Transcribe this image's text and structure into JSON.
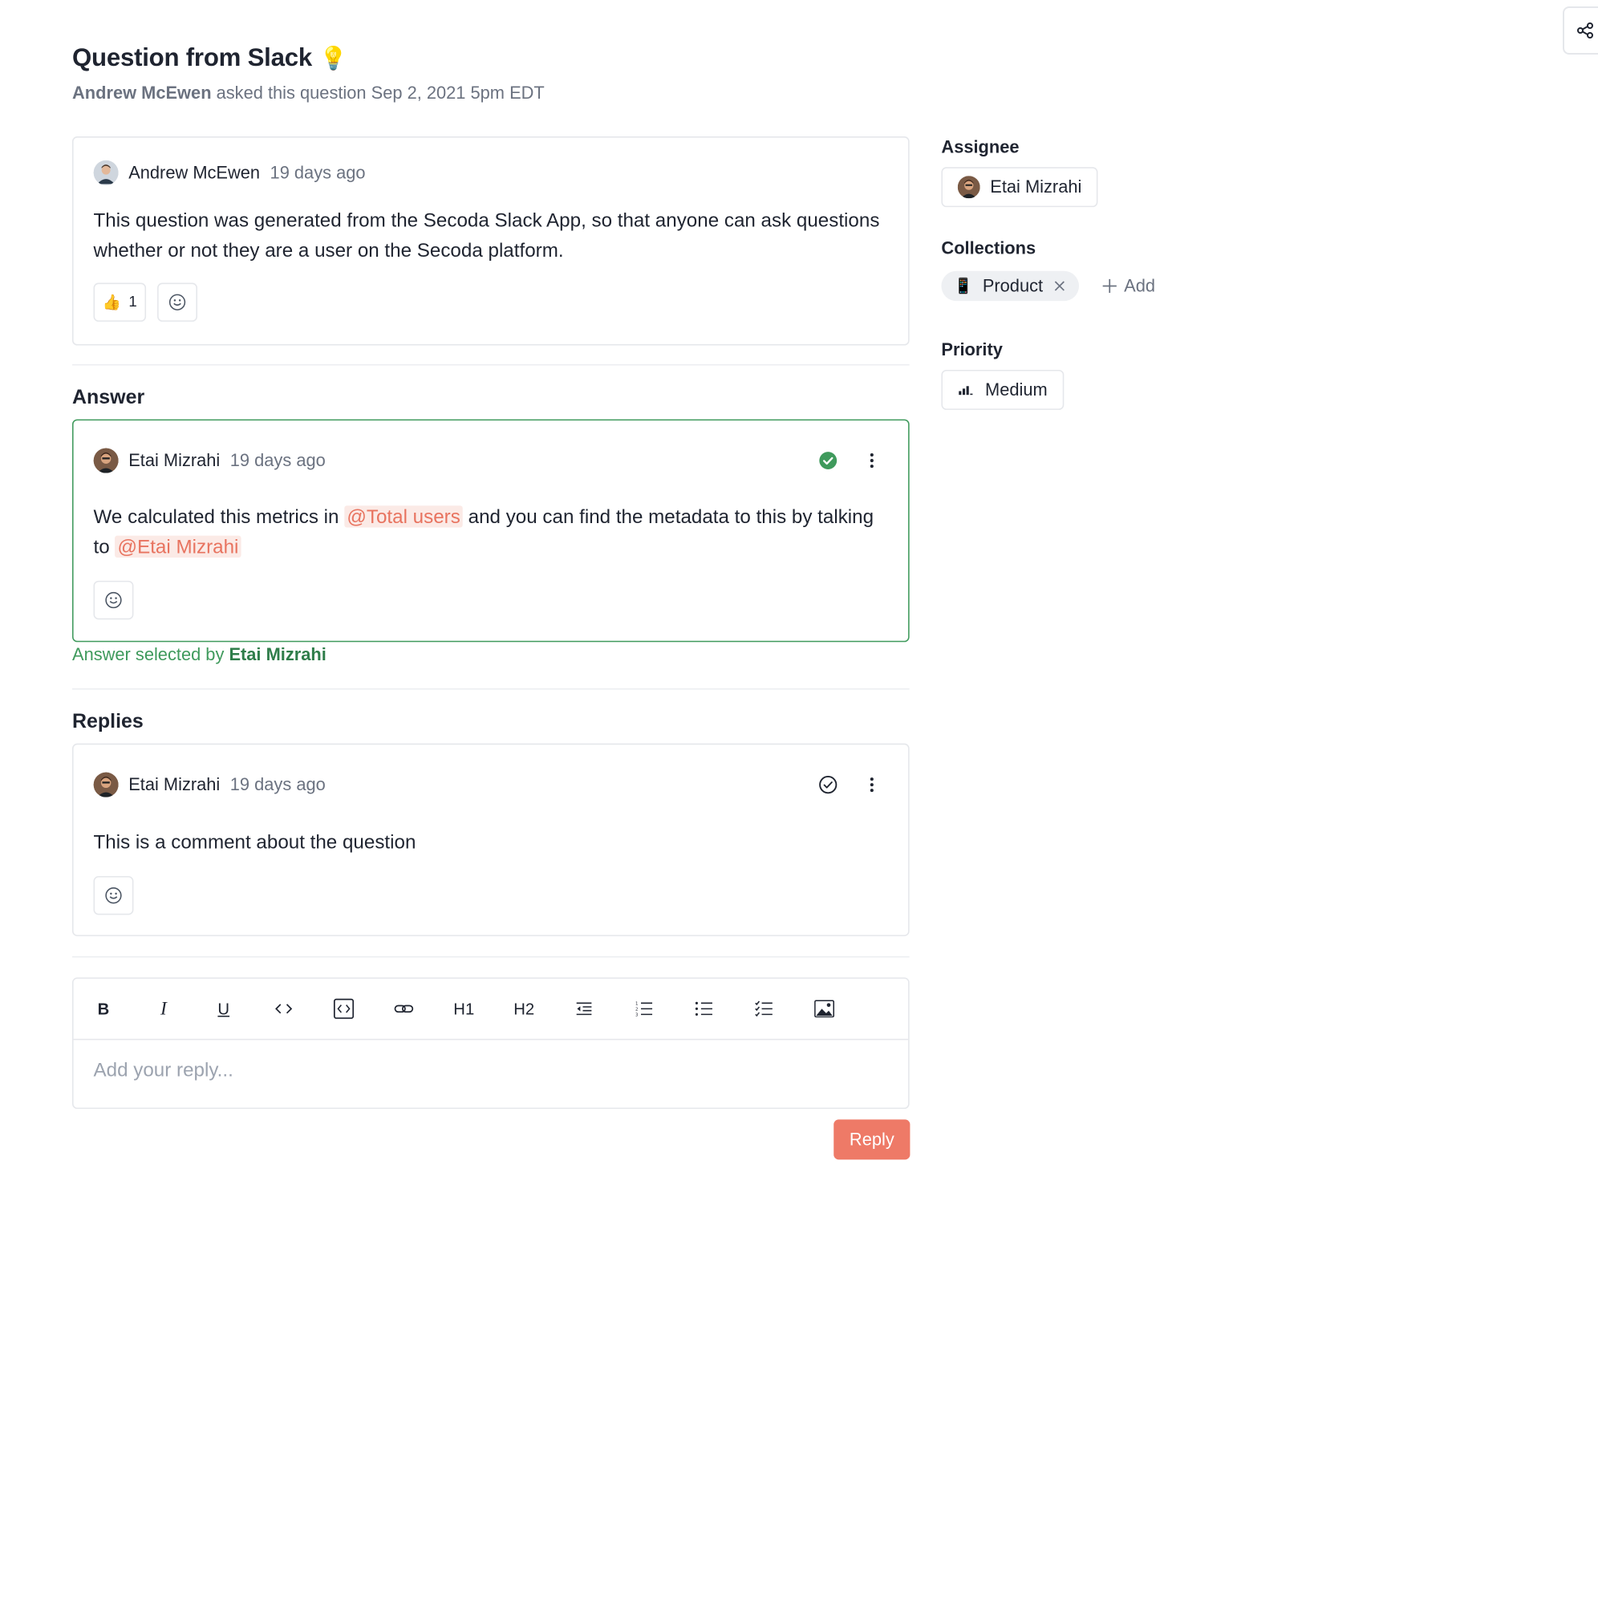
{
  "header": {
    "title": "Question from Slack",
    "title_emoji": "💡",
    "asker": "Andrew McEwen",
    "asked_text": "asked this question Sep 2, 2021 5pm EDT"
  },
  "question": {
    "author": "Andrew McEwen",
    "time": "19 days ago",
    "body": "This question was generated from the Secoda Slack App, so that anyone can ask questions whether or not they are a user on the Secoda platform.",
    "reaction_emoji": "👍",
    "reaction_count": "1"
  },
  "answer": {
    "section_title": "Answer",
    "author": "Etai Mizrahi",
    "time": "19 days ago",
    "body_part1": "We calculated this metrics in",
    "mention1": "@Total users",
    "body_part2": "and you can find the metadata to this by talking to",
    "mention2": "@Etai Mizrahi",
    "selected_prefix": "Answer selected by",
    "selected_by": "Etai Mizrahi",
    "status_color": "#3f9a5c"
  },
  "replies": {
    "section_title": "Replies",
    "items": [
      {
        "author": "Etai Mizrahi",
        "time": "19 days ago",
        "body": "This is a comment about the question"
      }
    ]
  },
  "editor": {
    "tools": [
      "B",
      "I",
      "U",
      "code-inline-icon",
      "code-block-icon",
      "link-icon",
      "H1",
      "H2",
      "indent-icon",
      "ordered-list-icon",
      "bullet-list-icon",
      "checklist-icon",
      "image-icon"
    ],
    "h1": "H1",
    "h2": "H2",
    "bold": "B",
    "italic": "I",
    "underline": "U",
    "placeholder": "Add your reply...",
    "reply_label": "Reply",
    "accent_color": "#ee7a67"
  },
  "sidebar": {
    "assignee_label": "Assignee",
    "assignee": "Etai Mizrahi",
    "collections_label": "Collections",
    "collection_emoji": "📱",
    "collection": "Product",
    "add_label": "Add",
    "priority_label": "Priority",
    "priority": "Medium"
  }
}
